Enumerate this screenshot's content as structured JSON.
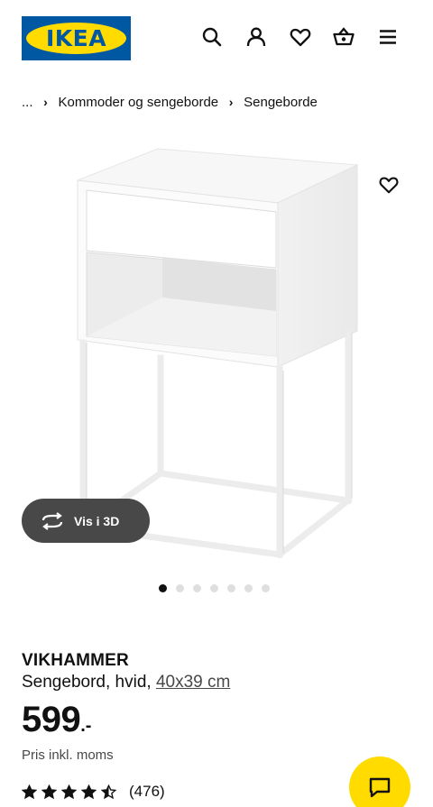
{
  "brand": {
    "logo_text": "IKEA",
    "colors": {
      "blue": "#0058a3",
      "yellow": "#ffdb00"
    }
  },
  "header": {
    "icons": [
      "search-icon",
      "user-icon",
      "heart-icon",
      "basket-icon",
      "menu-icon"
    ]
  },
  "breadcrumb": {
    "ellipsis": "...",
    "items": [
      "Kommoder og sengeborde",
      "Sengeborde"
    ]
  },
  "media": {
    "view_3d_label": "Vis i 3D",
    "image_count": 7,
    "active_index": 0
  },
  "product": {
    "name": "VIKHAMMER",
    "description": "Sengebord, hvid, ",
    "size": "40x39 cm",
    "price": "599",
    "price_suffix": ".-",
    "vat_note": "Pris inkl. moms",
    "rating": {
      "value": 4.5,
      "max": 5,
      "count": "(476)"
    }
  }
}
